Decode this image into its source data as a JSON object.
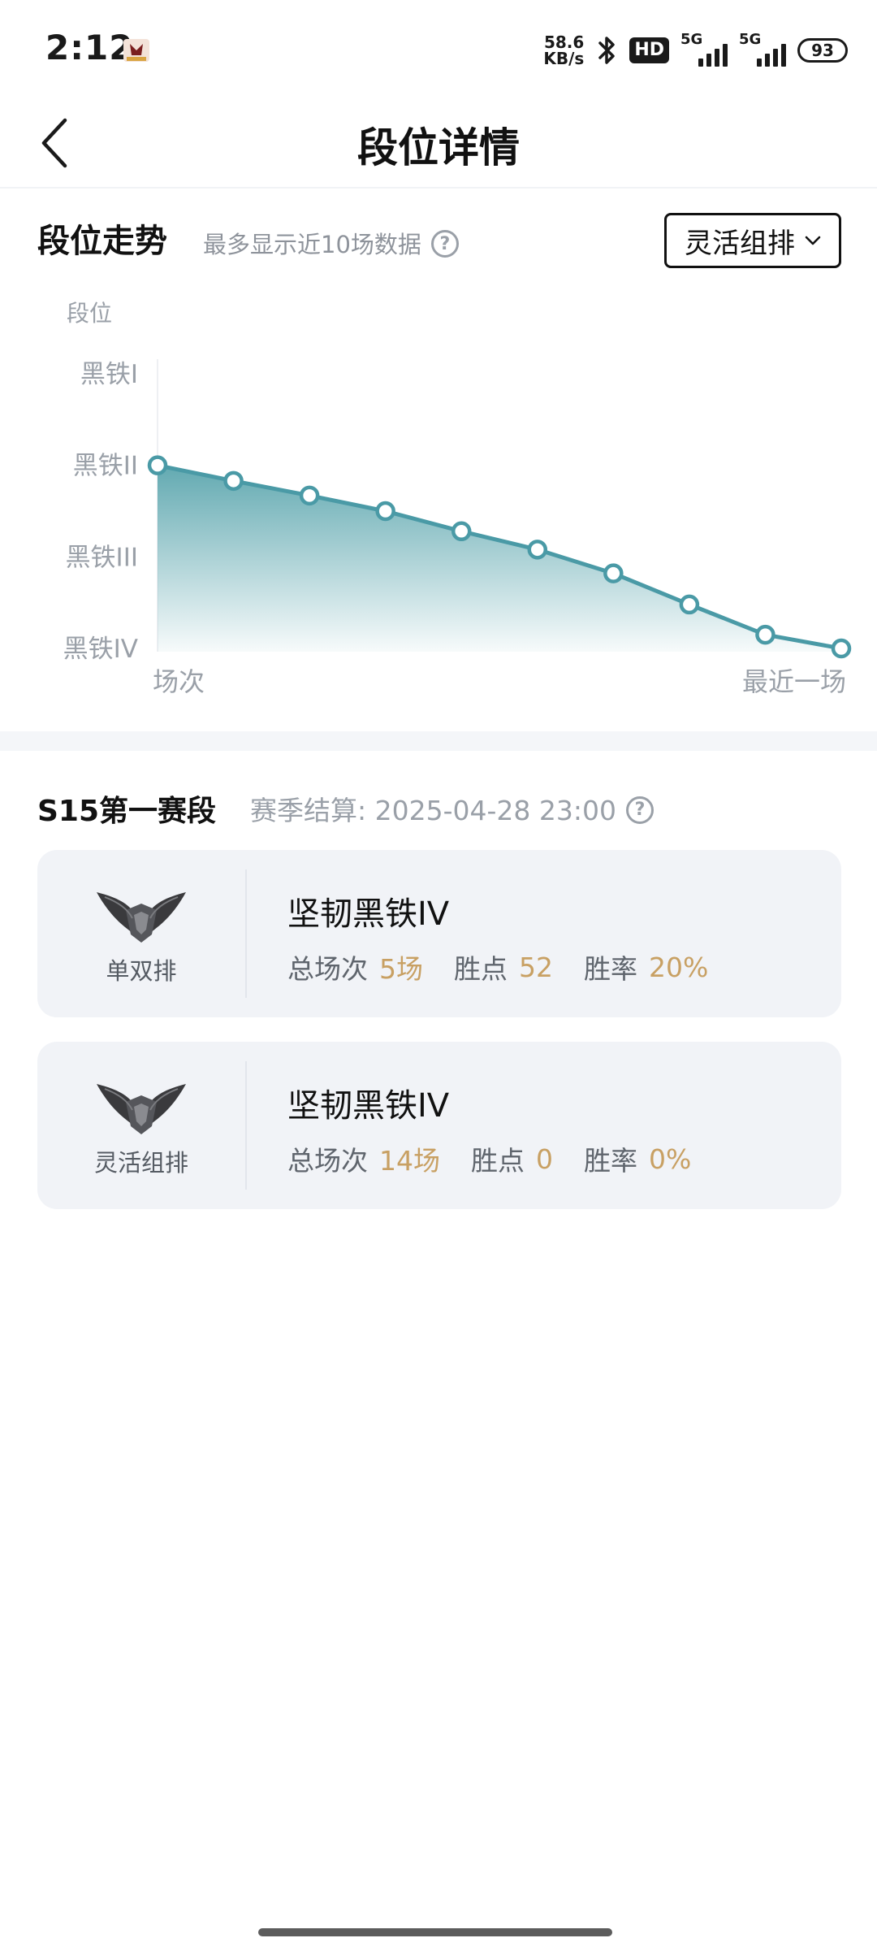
{
  "status_bar": {
    "time": "2:12",
    "net_speed_value": "58.6",
    "net_speed_unit": "KB/s",
    "hd_label": "HD",
    "signal1_label": "5G",
    "signal2_label": "5G",
    "battery": "93"
  },
  "header": {
    "title": "段位详情"
  },
  "trend": {
    "title": "段位走势",
    "subtitle": "最多显示近10场数据",
    "mode_select": "灵活组排"
  },
  "chart_data": {
    "type": "area",
    "ylabel": "段位",
    "y_categories": [
      "黑铁I",
      "黑铁II",
      "黑铁III",
      "黑铁IV"
    ],
    "xlabel_start": "场次",
    "xlabel_end": "最近一场",
    "x": [
      1,
      2,
      3,
      4,
      5,
      6,
      7,
      8,
      9,
      10
    ],
    "values": [
      2.0,
      2.17,
      2.33,
      2.5,
      2.72,
      2.92,
      3.18,
      3.52,
      3.85,
      4.0
    ],
    "y_scale": "1 = 黑铁I, 4 = 黑铁IV",
    "line_color": "#4a9aa6",
    "fill_color": "#6fb0b8"
  },
  "season": {
    "title": "S15第一赛段",
    "settle": "赛季结算: 2025-04-28 23:00"
  },
  "ranks": [
    {
      "queue": "单双排",
      "rank": "坚韧黑铁IV",
      "games_label": "总场次",
      "games_value": "5场",
      "lp_label": "胜点",
      "lp_value": "52",
      "winrate_label": "胜率",
      "winrate_value": "20%"
    },
    {
      "queue": "灵活组排",
      "rank": "坚韧黑铁IV",
      "games_label": "总场次",
      "games_value": "14场",
      "lp_label": "胜点",
      "lp_value": "0",
      "winrate_label": "胜率",
      "winrate_value": "0%"
    }
  ],
  "icons": {
    "back": "chevron-left-icon",
    "help": "question-circle-icon",
    "dropdown": "chevron-down-icon",
    "emblem": "iron-rank-emblem-icon"
  },
  "colors": {
    "accent_value": "#c8a063",
    "card_bg": "#f1f3f7"
  }
}
